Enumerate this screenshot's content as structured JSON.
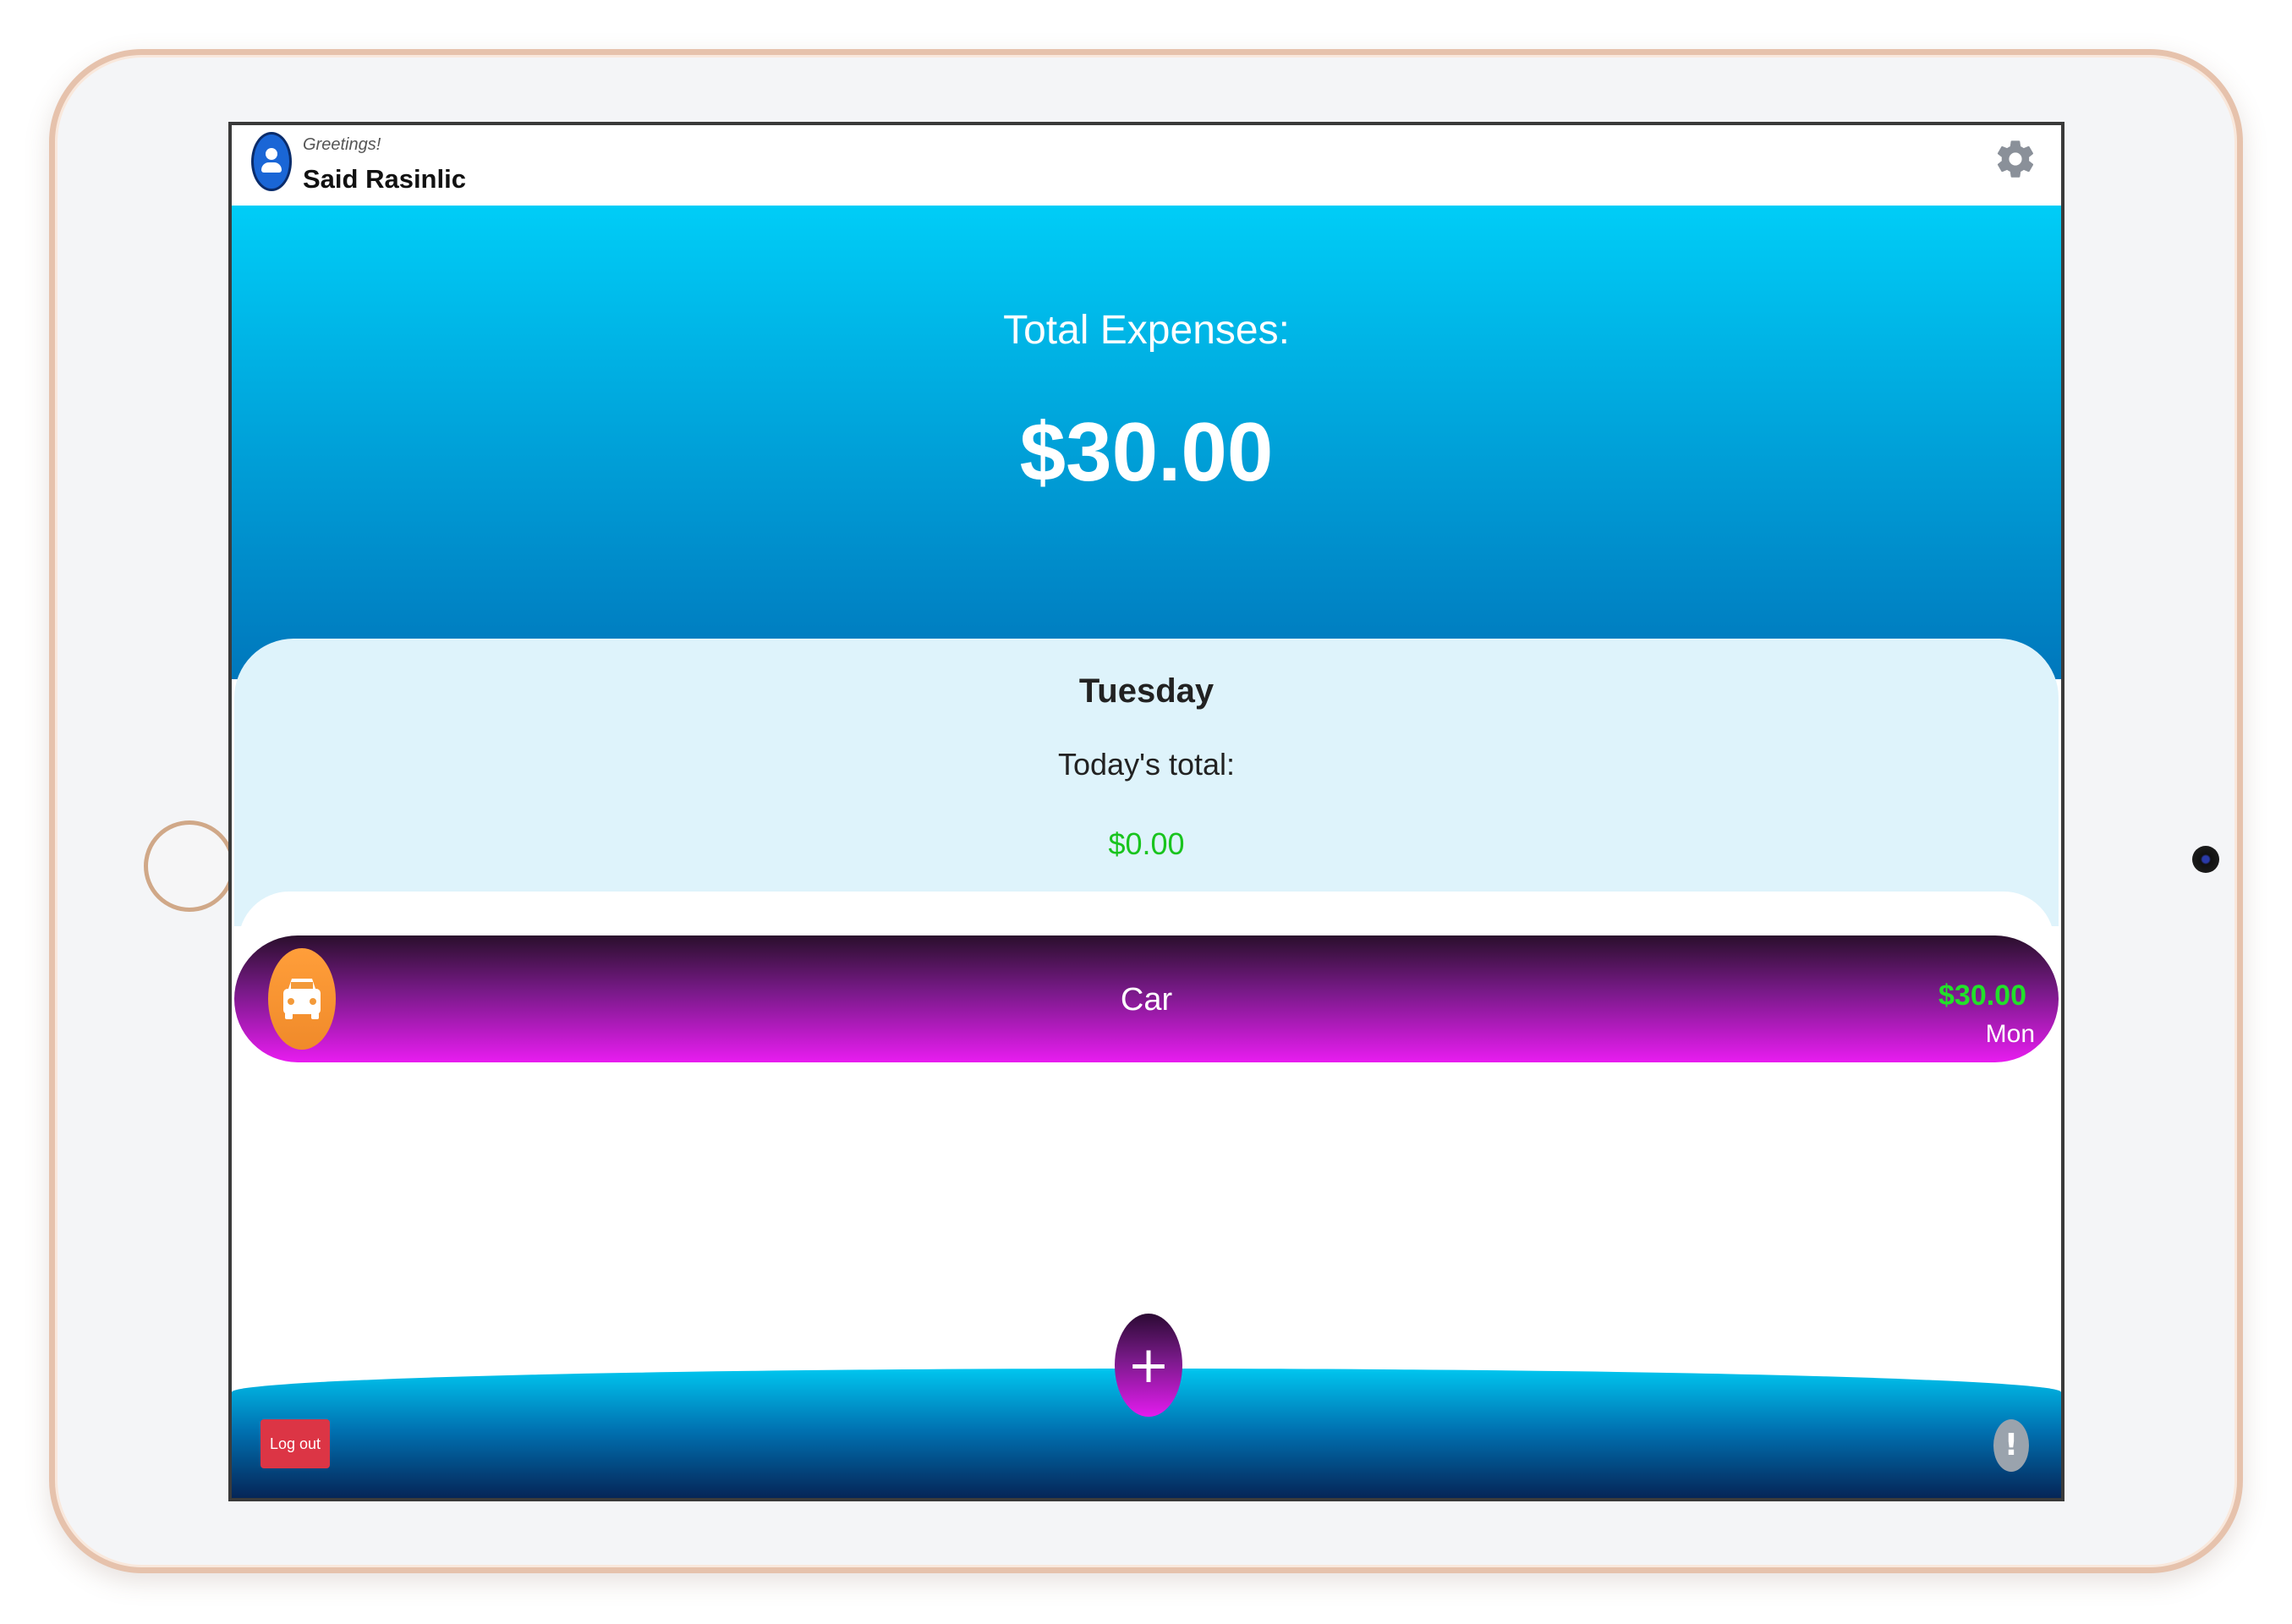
{
  "header": {
    "greeting": "Greetings!",
    "username": "Said Rasinlic",
    "avatar_icon": "user-avatar-icon",
    "settings_icon": "gear-icon"
  },
  "summary": {
    "label": "Total Expenses:",
    "value": "$30.00"
  },
  "day": {
    "name": "Tuesday",
    "today_label": "Today's total:",
    "today_value": "$0.00"
  },
  "expenses": [
    {
      "category": "Car",
      "amount": "$30.00",
      "day": "Mon",
      "icon": "car-icon"
    }
  ],
  "footer": {
    "logout_label": "Log out",
    "add_label": "+",
    "info_label": "!"
  },
  "colors": {
    "hero_top": "#00cdf7",
    "hero_bottom": "#0077bc",
    "panel_bg": "#def3fb",
    "positive_green": "#19c41e",
    "row_gradient_end": "#e81cf0",
    "logout_red": "#dc3545"
  }
}
